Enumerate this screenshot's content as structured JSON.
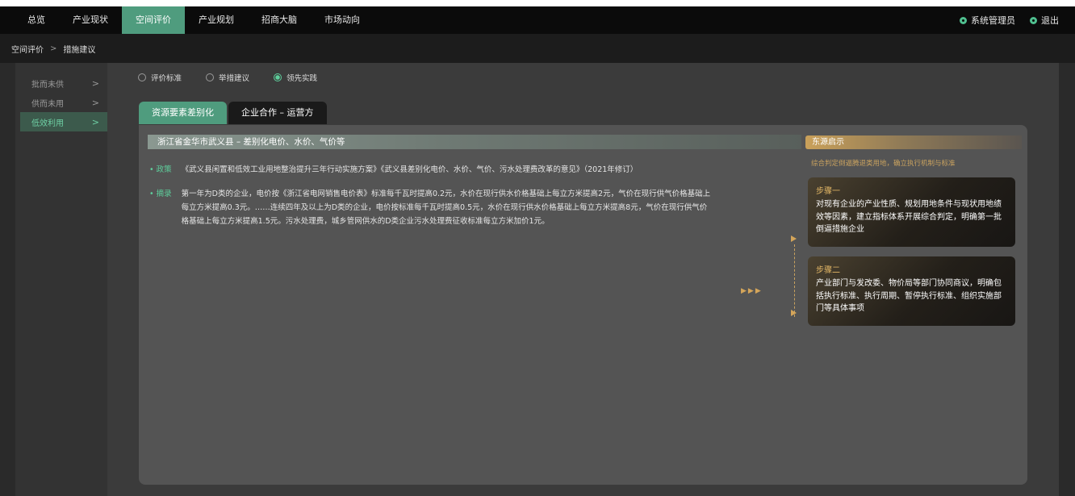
{
  "nav": {
    "items": [
      {
        "label": "总览"
      },
      {
        "label": "产业现状"
      },
      {
        "label": "空间评价"
      },
      {
        "label": "产业规划"
      },
      {
        "label": "招商大脑"
      },
      {
        "label": "市场动向"
      }
    ],
    "active_index": 2,
    "user_label": "系统管理员",
    "logout_label": "退出",
    "user_icon": "user-icon",
    "logout_icon": "power-icon"
  },
  "breadcrumb": {
    "parent": "空间评价",
    "separator": ">",
    "current": "措施建议"
  },
  "sidebar": {
    "items": [
      {
        "label": "批而未供",
        "chevron": ">"
      },
      {
        "label": "供而未用",
        "chevron": ">"
      },
      {
        "label": "低效利用",
        "chevron": ">"
      }
    ],
    "active_index": 2
  },
  "radios": {
    "options": [
      {
        "label": "评价标准"
      },
      {
        "label": "举措建议"
      },
      {
        "label": "领先实践"
      }
    ],
    "selected_index": 2
  },
  "tabs": [
    {
      "label": "资源要素差别化"
    },
    {
      "label": "企业合作 – 运营方"
    }
  ],
  "content": {
    "title": "浙江省金华市武义县 – 差别化电价、水价、气价等",
    "policy_label": "• 政策",
    "policy_text": "《武义县闲置和低效工业用地整治提升三年行动实施方案》《武义县差别化电价、水价、气价、污水处理费改革的意见》（2021年修订）",
    "summary_label": "• 摘录",
    "summary_text": "第一年为D类的企业，电价按《浙江省电网销售电价表》标准每千瓦时提高0.2元，水价在现行供水价格基础上每立方米提高2元，气价在现行供气价格基础上每立方米提高0.3元。……连续四年及以上为D类的企业，电价按标准每千瓦时提高0.5元，水价在现行供水价格基础上每立方米提高8元，气价在现行供气价格基础上每立方米提高1.5元。污水处理费，城乡管网供水的D类企业污水处理费征收标准每立方米加价1元。"
  },
  "insight": {
    "title": "东源启示",
    "subtitle": "综合判定倒逼腾退类用地，确立执行机制与标准",
    "arrows": "▶▶▶",
    "steps": [
      {
        "title": "步骤一",
        "text": "对现有企业的产业性质、规划用地条件与现状用地绩效等因素，建立指标体系开展综合判定，明确第一批倒逼措施企业"
      },
      {
        "title": "步骤二",
        "text": "产业部门与发改委、物价局等部门协同商议，明确包括执行标准、执行周期、暂停执行标准、组织实施部门等具体事项"
      }
    ]
  },
  "colors": {
    "accent_green": "#4f9c7e",
    "highlight_green": "#5ecf9c",
    "gold": "#d4a55a",
    "topbar": "#0b0b0b"
  }
}
